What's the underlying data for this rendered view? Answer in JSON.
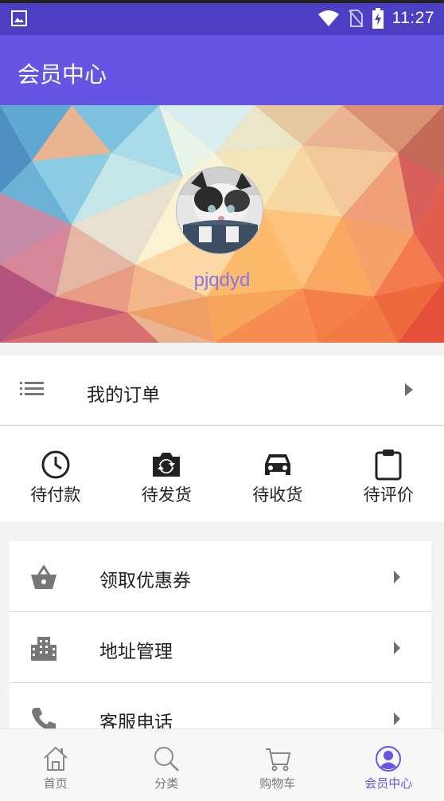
{
  "status_bar": {
    "time": "11:27"
  },
  "app_bar": {
    "title": "会员中心"
  },
  "profile": {
    "username": "pjqdyd"
  },
  "orders": {
    "label": "我的订单"
  },
  "order_status": [
    {
      "label": "待付款",
      "icon": "clock-icon"
    },
    {
      "label": "待发货",
      "icon": "camera-icon"
    },
    {
      "label": "待收货",
      "icon": "car-icon"
    },
    {
      "label": "待评价",
      "icon": "clipboard-icon"
    }
  ],
  "settings": [
    {
      "label": "领取优惠券",
      "icon": "basket-icon"
    },
    {
      "label": "地址管理",
      "icon": "building-icon"
    },
    {
      "label": "客服电话",
      "icon": "phone-icon"
    }
  ],
  "bottom_nav": [
    {
      "label": "首页",
      "icon": "home-icon",
      "active": false
    },
    {
      "label": "分类",
      "icon": "search-icon",
      "active": false
    },
    {
      "label": "购物车",
      "icon": "cart-icon",
      "active": false
    },
    {
      "label": "会员中心",
      "icon": "person-icon",
      "active": true
    }
  ],
  "colors": {
    "primary": "#6456e2",
    "status_bar": "#4d3fc4",
    "username": "#8677e6"
  }
}
